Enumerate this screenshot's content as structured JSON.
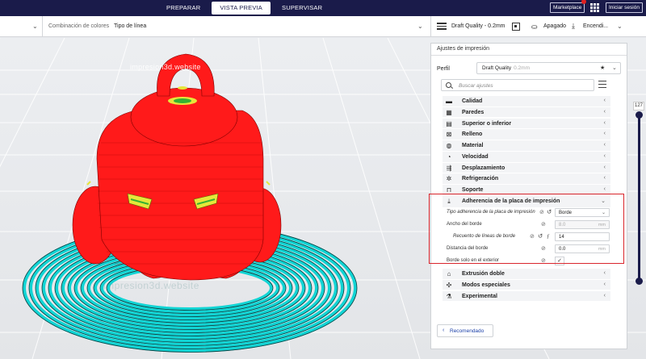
{
  "topbar": {
    "tabs": [
      {
        "label": "PREPARAR",
        "active": false
      },
      {
        "label": "VISTA PREVIA",
        "active": true
      },
      {
        "label": "SUPERVISAR",
        "active": false
      }
    ],
    "marketplace": "Marketplace",
    "login": "Iniciar sesión"
  },
  "subbar": {
    "color_combo": "Combinación de colores",
    "line_type": "Tipo de línea",
    "profile": "Draft Quality - 0.2mm",
    "adhesion_state": "Apagado",
    "enc": "Encendi..."
  },
  "viewport": {
    "watermark_top": "impresion3d.website",
    "watermark_bottom": "impresion3d.website",
    "layer_number": "127",
    "layer_progress": 1.0
  },
  "panel": {
    "title": "Ajustes de impresión",
    "perfil_label": "Perfil",
    "perfil_value": "Draft Quality",
    "perfil_sub": "0.2mm",
    "search_placeholder": "Buscar ajustes",
    "categories_top": [
      {
        "label": "Calidad",
        "icon": "quality-icon",
        "glyph": "▬"
      },
      {
        "label": "Paredes",
        "icon": "walls-icon",
        "glyph": "▦"
      },
      {
        "label": "Superior o inferior",
        "icon": "top-bottom-icon",
        "glyph": "▤"
      },
      {
        "label": "Relleno",
        "icon": "infill-icon",
        "glyph": "⊠"
      },
      {
        "label": "Material",
        "icon": "material-icon",
        "glyph": "◍"
      },
      {
        "label": "Velocidad",
        "icon": "speed-icon",
        "glyph": "◔"
      },
      {
        "label": "Desplazamiento",
        "icon": "travel-icon",
        "glyph": "⇶"
      },
      {
        "label": "Refrigeración",
        "icon": "cooling-icon",
        "glyph": "✲"
      },
      {
        "label": "Soporte",
        "icon": "support-icon",
        "glyph": "⊓"
      }
    ],
    "adhesion": {
      "label": "Adherencia de la placa de impresión",
      "settings": {
        "type_label": "Tipo adherencia de la placa de impresión",
        "type_value": "Borde",
        "width_label": "Ancho del borde",
        "width_value": "8.0",
        "width_unit": "mm",
        "count_label": "Recuento de líneas de borde",
        "count_value": "14",
        "distance_label": "Distancia del borde",
        "distance_value": "0.0",
        "distance_unit": "mm",
        "outside_label": "Borde solo en el exterior",
        "outside_checked": "✓"
      }
    },
    "categories_bottom": [
      {
        "label": "Extrusión doble",
        "icon": "dual-extrusion-icon",
        "glyph": "⌂"
      },
      {
        "label": "Modos especiales",
        "icon": "special-modes-icon",
        "glyph": "✣"
      },
      {
        "label": "Experimental",
        "icon": "experimental-icon",
        "glyph": "⚗"
      }
    ],
    "recommended": "Recomendado"
  },
  "colors": {
    "brand_dark": "#1a1b4a",
    "model_red": "#ff1a1a",
    "brim_cyan": "#12d4d4",
    "highlight_red": "#d9252c"
  }
}
